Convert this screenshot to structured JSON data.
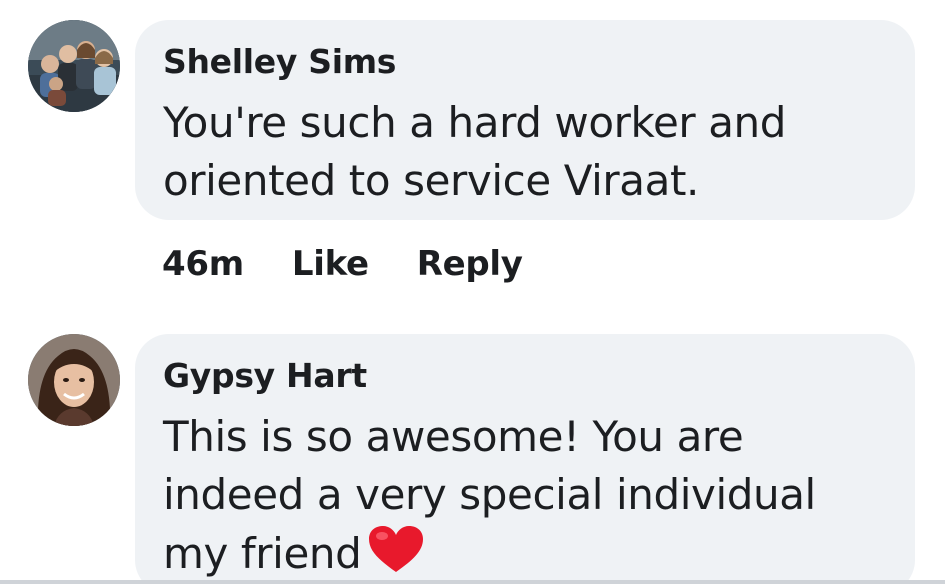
{
  "comments": [
    {
      "author": "Shelley Sims",
      "text_lines": [
        "You're such a hard worker and",
        "oriented to service Viraat."
      ],
      "timestamp": "46m",
      "like_label": "Like",
      "reply_label": "Reply",
      "avatar_icon": "group-photo-avatar"
    },
    {
      "author": "Gypsy Hart",
      "text_lines": [
        "This is so awesome! You are",
        "indeed a very special individual",
        "my friend"
      ],
      "emoji": "red-heart-icon",
      "avatar_icon": "woman-photo-avatar"
    }
  ],
  "colors": {
    "bubble_bg": "#eff2f5",
    "text": "#1c1e21",
    "heart": "#e8192c"
  }
}
